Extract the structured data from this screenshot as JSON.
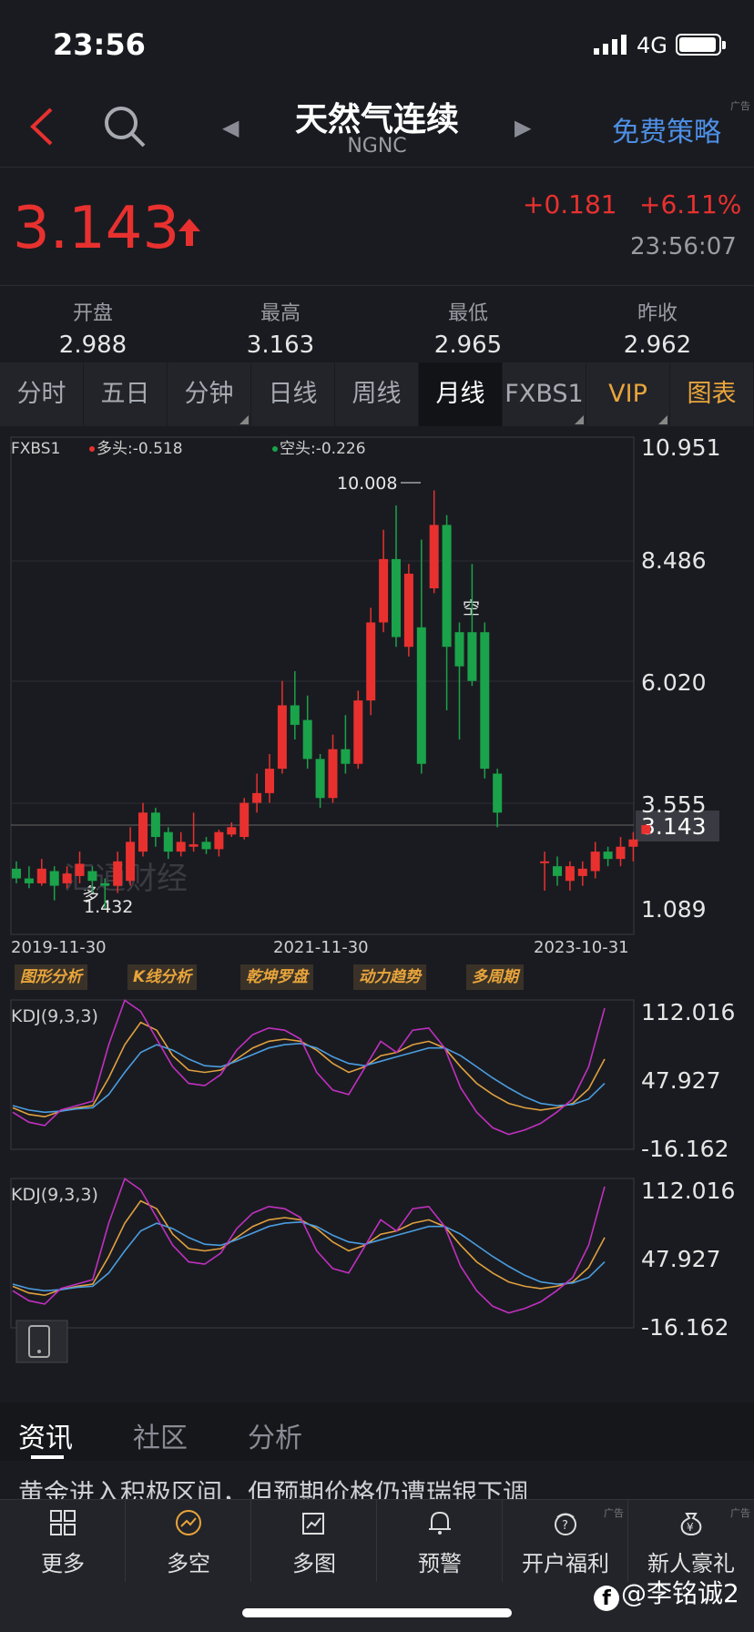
{
  "status": {
    "time": "23:56",
    "network": "4G"
  },
  "nav": {
    "title": "天然气连续",
    "subtitle": "NGNC",
    "strategy": "免费策略",
    "ad": "广告"
  },
  "quote": {
    "price": "3.143",
    "change": "+0.181",
    "change_pct": "+6.11%",
    "time": "23:56:07",
    "up_color": "#e8312f",
    "down_color": "#1aa34a"
  },
  "ohlc": [
    {
      "label": "开盘",
      "value": "2.988"
    },
    {
      "label": "最高",
      "value": "3.163"
    },
    {
      "label": "最低",
      "value": "2.965"
    },
    {
      "label": "昨收",
      "value": "2.962"
    }
  ],
  "period_tabs": [
    {
      "label": "分时",
      "dropdown": false
    },
    {
      "label": "五日",
      "dropdown": false
    },
    {
      "label": "分钟",
      "dropdown": true
    },
    {
      "label": "日线",
      "dropdown": false
    },
    {
      "label": "周线",
      "dropdown": false
    },
    {
      "label": "月线",
      "dropdown": false,
      "active": true
    },
    {
      "label": "FXBS1",
      "dropdown": true
    },
    {
      "label": "VIP",
      "dropdown": true
    },
    {
      "label": "图表",
      "dropdown": false
    }
  ],
  "main_chart": {
    "indicator": "FXBS1",
    "long_label": "多头:-0.518",
    "short_label": "空头:-0.226",
    "y_labels": [
      "10.951",
      "8.486",
      "6.020",
      "3.555",
      "1.089"
    ],
    "current_price": "3.143",
    "high_mark": "10.008",
    "low_mark": "1.432",
    "signal_long": "多",
    "signal_short": "空",
    "dates": [
      "2019-11-30",
      "2021-11-30",
      "2023-10-31"
    ],
    "watermark": "汇通财经"
  },
  "tools": [
    "图形分析",
    "K线分析",
    "乾坤罗盘",
    "动力趋势",
    "多周期"
  ],
  "kdj": [
    {
      "label": "KDJ(9,3,3)",
      "y_labels": [
        "112.016",
        "47.927",
        "-16.162"
      ]
    },
    {
      "label": "KDJ(9,3,3)",
      "y_labels": [
        "112.016",
        "47.927",
        "-16.162"
      ]
    }
  ],
  "chart_data": [
    {
      "type": "candlestick",
      "title": "FXBS1",
      "ylim": [
        1.089,
        10.951
      ],
      "x_labels": [
        "2019-11-30",
        "2021-11-30",
        "2023-10-31"
      ],
      "candles": [
        {
          "o": 2.25,
          "c": 2.05,
          "h": 2.4,
          "l": 1.95
        },
        {
          "o": 2.05,
          "c": 1.95,
          "h": 2.3,
          "l": 1.85
        },
        {
          "o": 1.95,
          "c": 2.25,
          "h": 2.45,
          "l": 1.9
        },
        {
          "o": 2.2,
          "c": 1.9,
          "h": 2.3,
          "l": 1.6
        },
        {
          "o": 1.95,
          "c": 2.15,
          "h": 2.3,
          "l": 1.85
        },
        {
          "o": 2.1,
          "c": 2.35,
          "h": 2.6,
          "l": 1.95
        },
        {
          "o": 2.2,
          "c": 2.0,
          "h": 2.3,
          "l": 1.75
        },
        {
          "o": 1.95,
          "c": 1.9,
          "h": 2.05,
          "l": 1.43
        },
        {
          "o": 1.9,
          "c": 2.4,
          "h": 2.6,
          "l": 1.75
        },
        {
          "o": 2.0,
          "c": 2.8,
          "h": 3.1,
          "l": 1.9
        },
        {
          "o": 2.6,
          "c": 3.4,
          "h": 3.6,
          "l": 2.5
        },
        {
          "o": 3.4,
          "c": 2.9,
          "h": 3.5,
          "l": 2.7
        },
        {
          "o": 3.0,
          "c": 2.6,
          "h": 3.1,
          "l": 2.45
        },
        {
          "o": 2.6,
          "c": 2.8,
          "h": 3.0,
          "l": 2.5
        },
        {
          "o": 2.7,
          "c": 2.75,
          "h": 3.4,
          "l": 2.6
        },
        {
          "o": 2.8,
          "c": 2.65,
          "h": 2.9,
          "l": 2.55
        },
        {
          "o": 2.65,
          "c": 3.0,
          "h": 3.05,
          "l": 2.5
        },
        {
          "o": 2.95,
          "c": 3.1,
          "h": 3.2,
          "l": 2.9
        },
        {
          "o": 2.9,
          "c": 3.6,
          "h": 3.7,
          "l": 2.85
        },
        {
          "o": 3.6,
          "c": 3.8,
          "h": 4.2,
          "l": 3.4
        },
        {
          "o": 3.8,
          "c": 4.3,
          "h": 4.6,
          "l": 3.6
        },
        {
          "o": 4.3,
          "c": 5.6,
          "h": 6.1,
          "l": 4.2
        },
        {
          "o": 5.6,
          "c": 5.2,
          "h": 6.3,
          "l": 4.9
        },
        {
          "o": 5.3,
          "c": 4.5,
          "h": 5.8,
          "l": 4.3
        },
        {
          "o": 4.5,
          "c": 3.7,
          "h": 4.6,
          "l": 3.5
        },
        {
          "o": 3.7,
          "c": 4.7,
          "h": 5.0,
          "l": 3.6
        },
        {
          "o": 4.7,
          "c": 4.4,
          "h": 5.4,
          "l": 4.2
        },
        {
          "o": 4.4,
          "c": 5.7,
          "h": 5.9,
          "l": 4.3
        },
        {
          "o": 5.7,
          "c": 7.3,
          "h": 7.6,
          "l": 5.4
        },
        {
          "o": 7.3,
          "c": 8.6,
          "h": 9.2,
          "l": 7.1
        },
        {
          "o": 8.6,
          "c": 7.0,
          "h": 9.7,
          "l": 6.8
        },
        {
          "o": 6.8,
          "c": 8.3,
          "h": 8.5,
          "l": 6.6
        },
        {
          "o": 7.2,
          "c": 4.4,
          "h": 9.0,
          "l": 4.2
        },
        {
          "o": 8.0,
          "c": 9.3,
          "h": 10.008,
          "l": 7.9
        },
        {
          "o": 9.3,
          "c": 6.8,
          "h": 9.5,
          "l": 5.5
        },
        {
          "o": 7.1,
          "c": 6.4,
          "h": 7.3,
          "l": 4.9
        },
        {
          "o": 7.1,
          "c": 6.1,
          "h": 8.5,
          "l": 6.0
        },
        {
          "o": 7.1,
          "c": 4.3,
          "h": 7.3,
          "l": 4.1
        },
        {
          "o": 4.2,
          "c": 3.4,
          "h": 4.3,
          "l": 3.1
        },
        {
          "o": 2.4,
          "c": 2.4,
          "h": 2.6,
          "l": 1.8
        },
        {
          "o": 2.3,
          "c": 2.1,
          "h": 2.5,
          "l": 1.9
        },
        {
          "o": 2.0,
          "c": 2.3,
          "h": 2.4,
          "l": 1.8
        },
        {
          "o": 2.1,
          "c": 2.25,
          "h": 2.4,
          "l": 1.9
        },
        {
          "o": 2.2,
          "c": 2.6,
          "h": 2.8,
          "l": 2.05
        },
        {
          "o": 2.6,
          "c": 2.45,
          "h": 2.7,
          "l": 2.3
        },
        {
          "o": 2.45,
          "c": 2.7,
          "h": 2.9,
          "l": 2.3
        },
        {
          "o": 2.7,
          "c": 2.85,
          "h": 3.0,
          "l": 2.4
        },
        {
          "o": 2.96,
          "c": 3.143,
          "h": 3.163,
          "l": 2.965
        }
      ]
    },
    {
      "type": "line",
      "title": "KDJ(9,3,3)",
      "ylim": [
        -16.162,
        112.016
      ],
      "series": [
        {
          "name": "K",
          "color": "#e0a040",
          "values": [
            18,
            12,
            10,
            15,
            18,
            20,
            45,
            75,
            95,
            88,
            65,
            52,
            50,
            52,
            62,
            72,
            78,
            80,
            78,
            70,
            58,
            50,
            55,
            65,
            68,
            75,
            78,
            72,
            55,
            40,
            30,
            22,
            18,
            16,
            18,
            22,
            35,
            62
          ]
        },
        {
          "name": "D",
          "color": "#4a9de0",
          "values": [
            20,
            16,
            14,
            15,
            17,
            18,
            30,
            50,
            68,
            75,
            70,
            62,
            56,
            55,
            60,
            66,
            72,
            75,
            76,
            72,
            64,
            58,
            56,
            60,
            64,
            68,
            72,
            72,
            65,
            55,
            45,
            36,
            28,
            22,
            20,
            21,
            26,
            40
          ]
        },
        {
          "name": "J",
          "color": "#c030c0",
          "values": [
            14,
            5,
            2,
            16,
            20,
            24,
            75,
            115,
            105,
            80,
            55,
            40,
            38,
            48,
            70,
            84,
            90,
            88,
            80,
            50,
            34,
            30,
            54,
            78,
            68,
            88,
            90,
            72,
            36,
            14,
            0,
            -6,
            -2,
            4,
            14,
            26,
            55,
            108
          ]
        }
      ]
    }
  ],
  "news": {
    "tabs": [
      "资讯",
      "社区",
      "分析"
    ],
    "headline": "黄金进入积极区间，但预期价格仍遭瑞银下调"
  },
  "bottom_nav": [
    {
      "label": "更多",
      "icon": "grid-icon",
      "ad": ""
    },
    {
      "label": "多空",
      "icon": "bull-bear-icon",
      "ad": ""
    },
    {
      "label": "多图",
      "icon": "multi-chart-icon",
      "ad": ""
    },
    {
      "label": "预警",
      "icon": "bell-icon",
      "ad": ""
    },
    {
      "label": "开户福利",
      "icon": "gift-icon",
      "ad": "广告"
    },
    {
      "label": "新人豪礼",
      "icon": "yen-bag-icon",
      "ad": "广告"
    }
  ],
  "watermark_text": "@李铭诚2"
}
